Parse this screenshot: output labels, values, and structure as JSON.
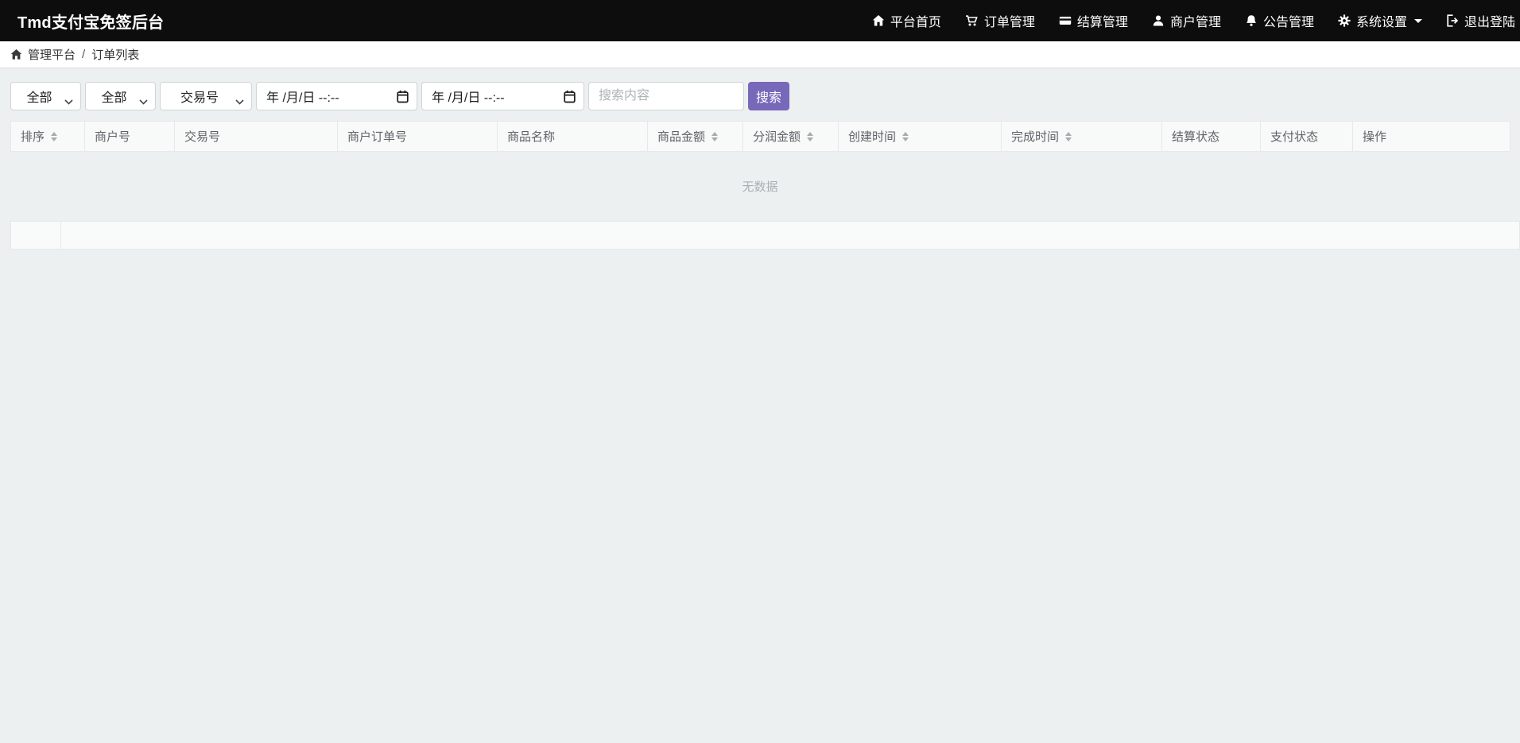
{
  "navbar": {
    "brand": "Tmd支付宝免签后台",
    "items": [
      {
        "label": "平台首页",
        "icon": "home-icon"
      },
      {
        "label": "订单管理",
        "icon": "cart-icon"
      },
      {
        "label": "结算管理",
        "icon": "credit-card-icon"
      },
      {
        "label": "商户管理",
        "icon": "user-icon"
      },
      {
        "label": "公告管理",
        "icon": "bell-icon"
      },
      {
        "label": "系统设置",
        "icon": "gear-icon",
        "has_dropdown": true
      },
      {
        "label": "退出登陆",
        "icon": "logout-icon"
      }
    ]
  },
  "breadcrumb": {
    "root": "管理平台",
    "separator": "/",
    "current": "订单列表"
  },
  "filters": {
    "status_select_value": "全部",
    "type_select_value": "全部",
    "field_select_value": "交易号",
    "date_start_value": "年 /月/日 --:--",
    "date_end_value": "年 /月/日 --:--",
    "search_placeholder": "搜索内容",
    "search_button": "搜索"
  },
  "table": {
    "columns": [
      {
        "label": "排序",
        "sortable": true
      },
      {
        "label": "商户号",
        "sortable": false
      },
      {
        "label": "交易号",
        "sortable": false
      },
      {
        "label": "商户订单号",
        "sortable": false
      },
      {
        "label": "商品名称",
        "sortable": false
      },
      {
        "label": "商品金额",
        "sortable": true
      },
      {
        "label": "分润金额",
        "sortable": true
      },
      {
        "label": "创建时间",
        "sortable": true
      },
      {
        "label": "完成时间",
        "sortable": true
      },
      {
        "label": "结算状态",
        "sortable": false
      },
      {
        "label": "支付状态",
        "sortable": false
      },
      {
        "label": "操作",
        "sortable": false
      }
    ],
    "empty_text": "无数据"
  },
  "colors": {
    "navbar_bg": "#0d0d0d",
    "page_bg": "#edf0f1",
    "panel_bg": "#f8f9f9",
    "accent": "#7768b9",
    "border": "#e6e9e9"
  }
}
